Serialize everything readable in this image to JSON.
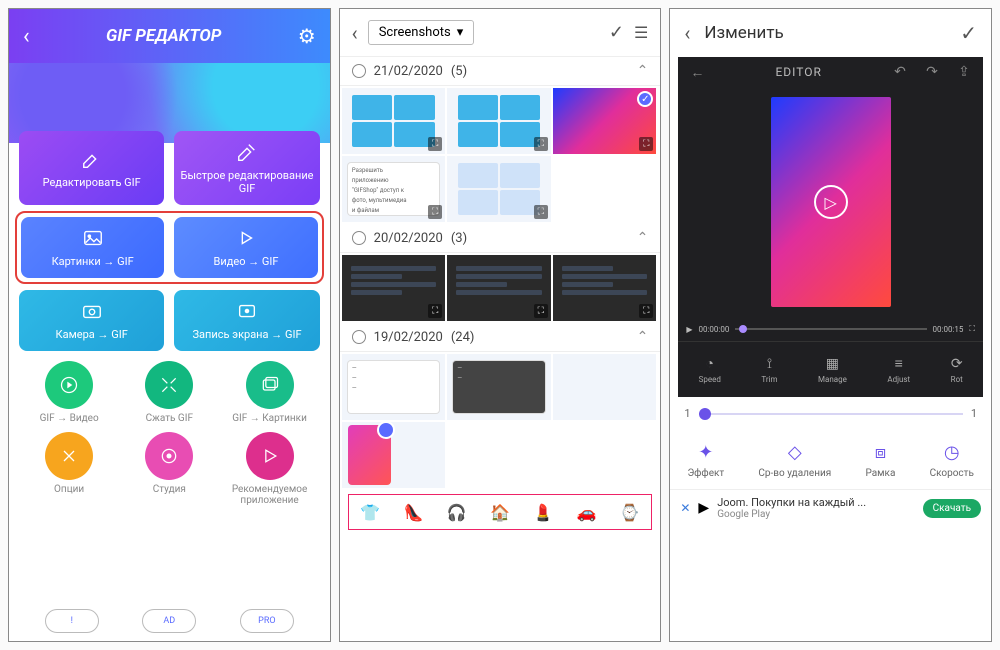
{
  "screen1": {
    "title": "GIF РЕДАКТОР",
    "tiles": {
      "edit_gif": "Редактировать GIF",
      "quick_edit": "Быстрое редактирование GIF",
      "pics_to_gif": "Картинки → GIF",
      "video_to_gif": "Видео → GIF",
      "camera_to_gif": "Камера → GIF",
      "record_to_gif": "Запись экрана → GIF"
    },
    "circles": {
      "gif_to_video": "GIF → Видео",
      "compress": "Сжать GIF",
      "gif_to_pics": "GIF → Картинки",
      "options": "Опции",
      "studio": "Студия",
      "recommended": "Рекомендуемое приложение"
    },
    "pills": {
      "info": "!",
      "ad": "AD",
      "pro": "PRO"
    }
  },
  "screen2": {
    "folder": "Screenshots",
    "sections": [
      {
        "date": "21/02/2020",
        "count": "(5)"
      },
      {
        "date": "20/02/2020",
        "count": "(3)"
      },
      {
        "date": "19/02/2020",
        "count": "(24)"
      }
    ]
  },
  "screen3": {
    "title": "Изменить",
    "editor_label": "EDITOR",
    "time_start": "00:00:00",
    "time_end": "00:00:15",
    "editor_tools": {
      "speed": "Speed",
      "trim": "Trim",
      "manage": "Manage",
      "adjust": "Adjust",
      "rot": "Rot"
    },
    "slider_min": "1",
    "slider_max": "1",
    "tools": {
      "effect": "Эффект",
      "remove": "Ср-во удаления",
      "frame": "Рамка",
      "speed": "Скорость"
    },
    "ad": {
      "text": "Joom. Покупки на каждый ...",
      "sub": "Google Play",
      "button": "Скачать"
    }
  }
}
